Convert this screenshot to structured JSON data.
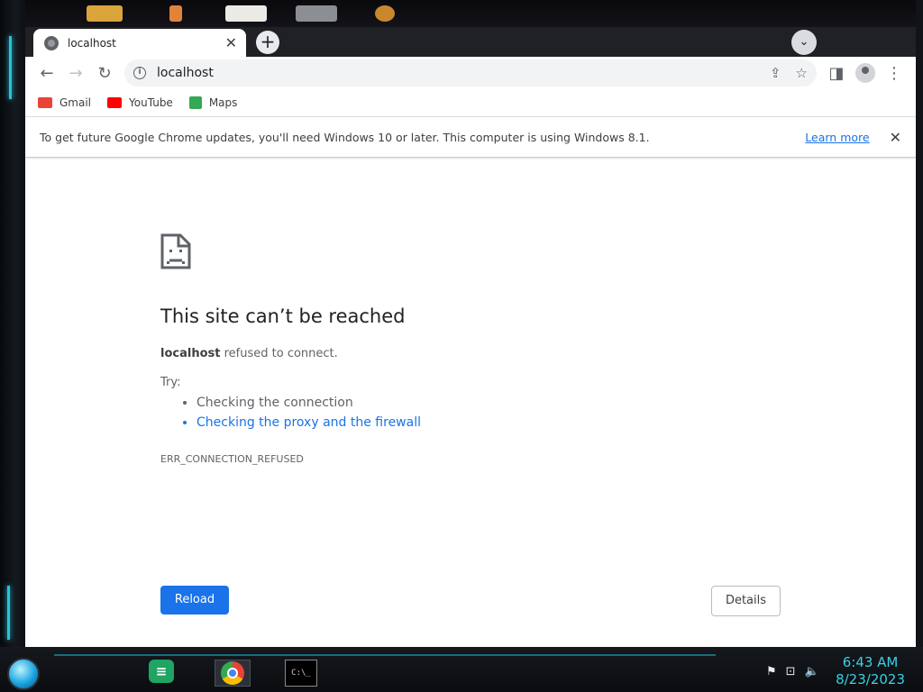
{
  "tab": {
    "title": "localhost"
  },
  "omnibox": {
    "url": "localhost"
  },
  "bookmarks": [
    {
      "label": "Gmail",
      "color": "#ea4335"
    },
    {
      "label": "YouTube",
      "color": "#ff0000"
    },
    {
      "label": "Maps",
      "color": "#34a853"
    }
  ],
  "infobar": {
    "message": "To get future Google Chrome updates, you'll need Windows 10 or later. This computer is using Windows 8.1.",
    "link": "Learn more"
  },
  "error": {
    "heading": "This site can’t be reached",
    "host": "localhost",
    "detail_rest": " refused to connect.",
    "try_label": "Try:",
    "suggestions": [
      "Checking the connection",
      "Checking the proxy and the firewall"
    ],
    "code": "ERR_CONNECTION_REFUSED",
    "reload_label": "Reload",
    "details_label": "Details"
  },
  "taskbar": {
    "time": "6:43 AM",
    "date": "8/23/2023",
    "cmd_label": "C:\\_"
  },
  "colors": {
    "accent": "#1a73e8",
    "tab_strip": "#202124",
    "taskbar_glow": "#27c3d6"
  }
}
